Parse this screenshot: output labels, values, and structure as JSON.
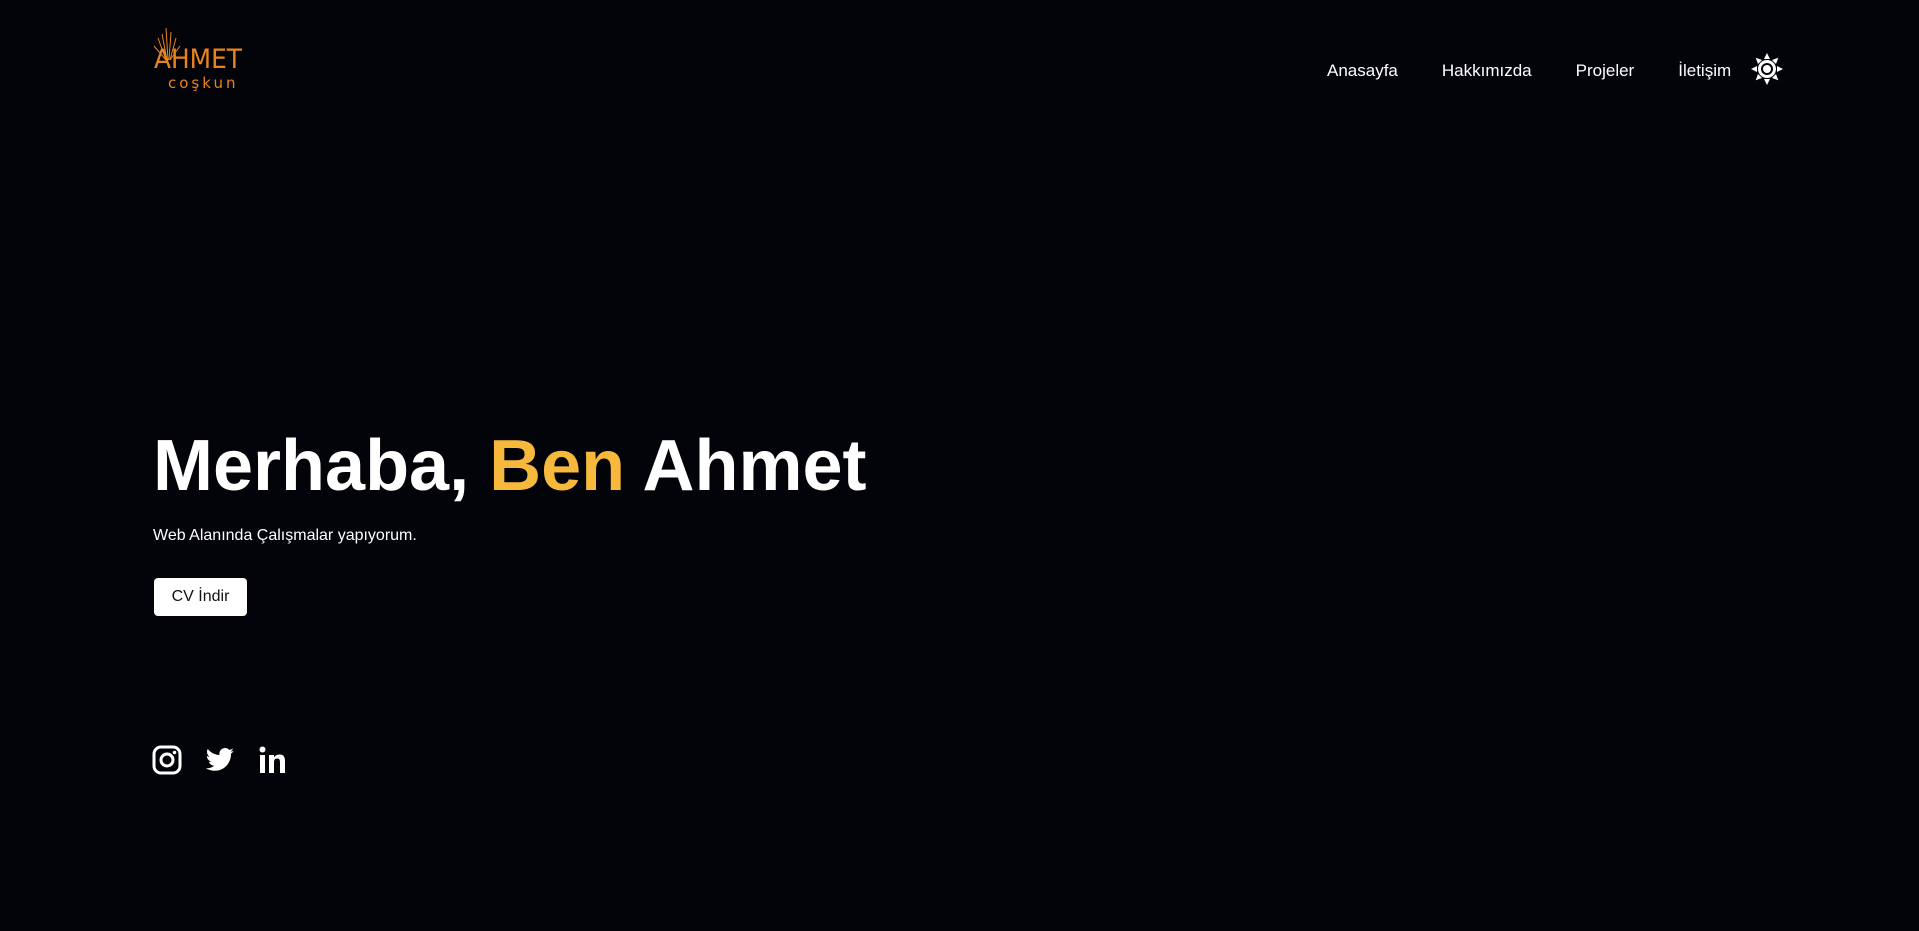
{
  "logo": {
    "main": "AHMET",
    "sub": "coşkun",
    "color": "#e8841f"
  },
  "nav": {
    "items": [
      {
        "label": "Anasayfa"
      },
      {
        "label": "Hakkımızda"
      },
      {
        "label": "Projeler"
      },
      {
        "label": "İletişim"
      }
    ],
    "theme_icon": "sun-icon"
  },
  "hero": {
    "title_part1": "Merhaba,",
    "title_accent": "Ben",
    "title_part2": "Ahmet",
    "subtitle": "Web Alanında Çalışmalar yapıyorum.",
    "cv_button": "CV İndir",
    "accent_color": "#f6b93b"
  },
  "social": {
    "icons": [
      "instagram-icon",
      "twitter-icon",
      "linkedin-icon"
    ]
  },
  "colors": {
    "background": "#03030a",
    "text": "#ffffff"
  }
}
